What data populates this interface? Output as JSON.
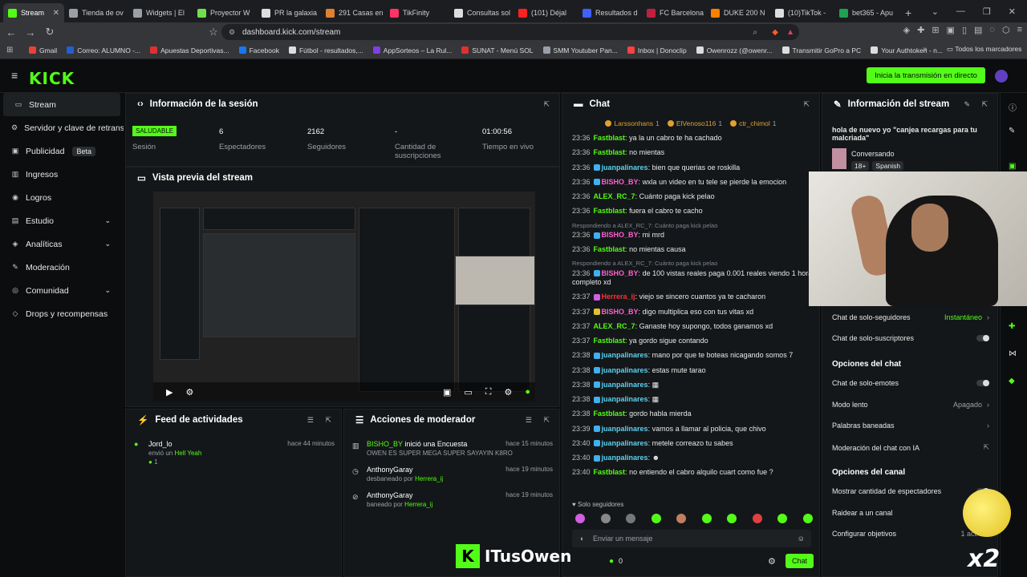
{
  "browser": {
    "tabs": [
      {
        "label": "Stream",
        "color": "#53fc18",
        "active": true
      },
      {
        "label": "Tienda de ov",
        "color": "#9aa0a6"
      },
      {
        "label": "Widgets | El",
        "color": "#9aa0a6"
      },
      {
        "label": "Proyector W",
        "color": "#6ee050"
      },
      {
        "label": "PR la galaxia",
        "color": "#ddd"
      },
      {
        "label": "291 Casas en",
        "color": "#e08030"
      },
      {
        "label": "TikFinity",
        "color": "#ff3366"
      },
      {
        "label": "Consultas sol",
        "color": "#ddd"
      },
      {
        "label": "(101) Déjal",
        "color": "#ff2020"
      },
      {
        "label": "Resultados d",
        "color": "#4060ff"
      },
      {
        "label": "FC Barcelona",
        "color": "#c02040"
      },
      {
        "label": "DUKE 200 N",
        "color": "#ff8000"
      },
      {
        "label": "(10)TikTok -",
        "color": "#ddd"
      },
      {
        "label": "bet365 - Apu",
        "color": "#20a050"
      }
    ],
    "url": "dashboard.kick.com/stream",
    "bookmarks": [
      {
        "label": "Gmail",
        "color": "#ea4335"
      },
      {
        "label": "Correo: ALUMNO -...",
        "color": "#2060d0"
      },
      {
        "label": "Apuestas Deportivas...",
        "color": "#e03030"
      },
      {
        "label": "Facebook",
        "color": "#1877f2"
      },
      {
        "label": "Fútbol - resultados,...",
        "color": "#ddd"
      },
      {
        "label": "AppSorteos – La Rul...",
        "color": "#8040e0"
      },
      {
        "label": "SUNAT - Menú SOL",
        "color": "#e03030"
      },
      {
        "label": "SMM Youtuber Pan...",
        "color": "#9aa0a6"
      },
      {
        "label": "Inbox | Donoclip",
        "color": "#ff4040"
      },
      {
        "label": "Owenrozz (@owenr...",
        "color": "#ddd"
      },
      {
        "label": "Transmitir GoPro a PC",
        "color": "#ddd"
      },
      {
        "label": "Your Authtoken - n...",
        "color": "#ddd"
      }
    ],
    "all_bookmarks": "Todos los marcadores"
  },
  "header": {
    "logo": "KICK",
    "go_live": "Inicia la transmisión en directo"
  },
  "sidebar": {
    "items": [
      {
        "label": "Stream",
        "icon": "▭",
        "active": true
      },
      {
        "label": "Servidor y clave de retransmisión",
        "icon": "⚙"
      },
      {
        "label": "Publicidad",
        "icon": "▣",
        "badge": "Beta"
      },
      {
        "label": "Ingresos",
        "icon": "▥"
      },
      {
        "label": "Logros",
        "icon": "◉"
      },
      {
        "label": "Estudio",
        "icon": "▤",
        "chevron": true
      },
      {
        "label": "Analíticas",
        "icon": "◈",
        "chevron": true
      },
      {
        "label": "Moderación",
        "icon": "✎"
      },
      {
        "label": "Comunidad",
        "icon": "◎",
        "chevron": true
      },
      {
        "label": "Drops y recompensas",
        "icon": "◇"
      }
    ]
  },
  "session": {
    "title": "Información de la sesión",
    "status": "SALUDABLE",
    "status_label": "Sesión",
    "stats": [
      {
        "value": "6",
        "label": "Espectadores"
      },
      {
        "value": "2162",
        "label": "Seguidores"
      },
      {
        "value": "-",
        "label": "Cantidad de suscripciones"
      },
      {
        "value": "01:00:56",
        "label": "Tiempo en vivo"
      }
    ]
  },
  "preview": {
    "title": "Vista previa del stream"
  },
  "feed": {
    "title": "Feed de actividades",
    "events": [
      {
        "name": "Jord_lo",
        "sub_prefix": "envió un",
        "sub_item": "Hell Yeah",
        "count": "1",
        "time": "hace 44 minutos"
      }
    ]
  },
  "mod": {
    "title": "Acciones de moderador",
    "events": [
      {
        "name": "BISHO_BY",
        "action": "inició una Encuesta",
        "sub": "OWEN ES SUPER MEGA SUPER SAYAYIN K8RO",
        "time": "hace 15 minutos"
      },
      {
        "name": "AnthonyGaray",
        "sub_prefix": "desbaneado por",
        "by": "Herrera_ij",
        "time": "hace 19 minutos"
      },
      {
        "name": "AnthonyGaray",
        "sub_prefix": "baneado por",
        "by": "Herrera_ij",
        "time": "hace 19 minutos"
      }
    ]
  },
  "chat": {
    "title": "Chat",
    "pinned": [
      {
        "name": "Larssonhans",
        "count": "1"
      },
      {
        "name": "ElVenoso116",
        "count": "1"
      },
      {
        "name": "ctr_chimol",
        "count": "1"
      }
    ],
    "messages": [
      {
        "t": "23:36",
        "user": "Fastblast",
        "uc": "grn",
        "text": "ya la un cabro te ha cachado"
      },
      {
        "t": "23:36",
        "user": "Fastblast",
        "uc": "grn",
        "text": "no mientas"
      },
      {
        "t": "23:36",
        "user": "juanpalinares",
        "uc": "cyan",
        "b": "bd",
        "text": "bien que querias oe roskilla"
      },
      {
        "t": "23:36",
        "user": "BISHO_BY",
        "uc": "pink",
        "b": "bd",
        "text": "wxla un video en tu tele se pierde la emocion"
      },
      {
        "t": "23:36",
        "user": "ALEX_RC_7",
        "uc": "grn",
        "text": "Cuánto paga kick pelao"
      },
      {
        "t": "23:36",
        "user": "Fastblast",
        "uc": "grn",
        "text": "fuera el cabro te cacho"
      },
      {
        "reply": "Respondiendo a ALEX_RC_7: Cuánto paga kick pelao",
        "t": "23:36",
        "user": "BISHO_BY",
        "uc": "pink",
        "b": "bd",
        "text": "mi mrd"
      },
      {
        "t": "23:36",
        "user": "Fastblast",
        "uc": "grn",
        "text": "no mientas causa"
      },
      {
        "reply": "Respondiendo a ALEX_RC_7: Cuánto paga kick pelao",
        "t": "23:36",
        "user": "BISHO_BY",
        "uc": "pink",
        "b": "bd",
        "text": "de 100 vistas reales paga 0.001 reales viendo 1 hora completo xd"
      },
      {
        "t": "23:37",
        "user": "Herrera_ij",
        "uc": "red",
        "b": "bd p",
        "text": "viejo se sincero cuantos ya te cacharon"
      },
      {
        "t": "23:37",
        "user": "BISHO_BY",
        "uc": "pink",
        "b": "bd y",
        "text": "digo multiplica eso con tus vitas xd"
      },
      {
        "t": "23:37",
        "user": "ALEX_RC_7",
        "uc": "grn",
        "text": "Ganaste hoy supongo, todos ganamos xd"
      },
      {
        "t": "23:37",
        "user": "Fastblast",
        "uc": "grn",
        "text": "ya gordo sigue contando"
      },
      {
        "t": "23:38",
        "user": "juanpalinares",
        "uc": "cyan",
        "b": "bd",
        "text": "mano por que te boteas nicagando somos 7"
      },
      {
        "t": "23:38",
        "user": "juanpalinares",
        "uc": "cyan",
        "b": "bd",
        "text": "estas mute tarao"
      },
      {
        "t": "23:38",
        "user": "juanpalinares",
        "uc": "cyan",
        "b": "bd",
        "text": "▦"
      },
      {
        "t": "23:38",
        "user": "juanpalinares",
        "uc": "cyan",
        "b": "bd",
        "text": "▦"
      },
      {
        "t": "23:38",
        "user": "Fastblast",
        "uc": "grn",
        "text": "gordo habla mierda"
      },
      {
        "t": "23:39",
        "user": "juanpalinares",
        "uc": "cyan",
        "b": "bd",
        "text": "vamos a llamar al policia, que chivo"
      },
      {
        "t": "23:40",
        "user": "juanpalinares",
        "uc": "cyan",
        "b": "bd",
        "text": "metele correazo tu sabes"
      },
      {
        "t": "23:40",
        "user": "juanpalinares",
        "uc": "cyan",
        "b": "bd",
        "text": "☻"
      },
      {
        "t": "23:40",
        "user": "Fastblast",
        "uc": "grn",
        "text": "no entiendo el cabro alquilo cuart como fue ?"
      }
    ],
    "solo": "Solo seguidores",
    "input_placeholder": "Enviar un mensaje",
    "points": "0",
    "send": "Chat"
  },
  "info": {
    "title": "Información del stream",
    "stream_title": "hola de nuevo yo \"canjea recargas para tu malcriada\"",
    "category": "Conversando",
    "tags": [
      "18+",
      "Spanish"
    ],
    "rows": [
      {
        "label": "Chat de solo-seguidores",
        "value": "Instantáneo",
        "type": "chev"
      },
      {
        "label": "Chat de solo-suscriptores",
        "type": "toggle"
      }
    ],
    "chat_options_title": "Opciones del chat",
    "chat_rows": [
      {
        "label": "Chat de solo-emotes",
        "type": "toggle"
      },
      {
        "label": "Modo lento",
        "value": "Apagado",
        "type": "chev"
      },
      {
        "label": "Palabras baneadas",
        "type": "chev"
      },
      {
        "label": "Moderación del chat con IA",
        "type": "ext"
      }
    ],
    "channel_options_title": "Opciones del canal",
    "channel_rows": [
      {
        "label": "Mostrar cantidad de espectadores",
        "type": "toggle"
      },
      {
        "label": "Raidear a un canal",
        "type": "none"
      },
      {
        "label": "Configurar objetivos",
        "value": "1 activas",
        "type": "none"
      }
    ]
  },
  "overlay": {
    "k": "K",
    "name": "ITusOwen",
    "multiplier": "x2"
  },
  "colors": {
    "brand": "#53fc18",
    "bg": "#0b0d0e",
    "panel": "#141719"
  }
}
